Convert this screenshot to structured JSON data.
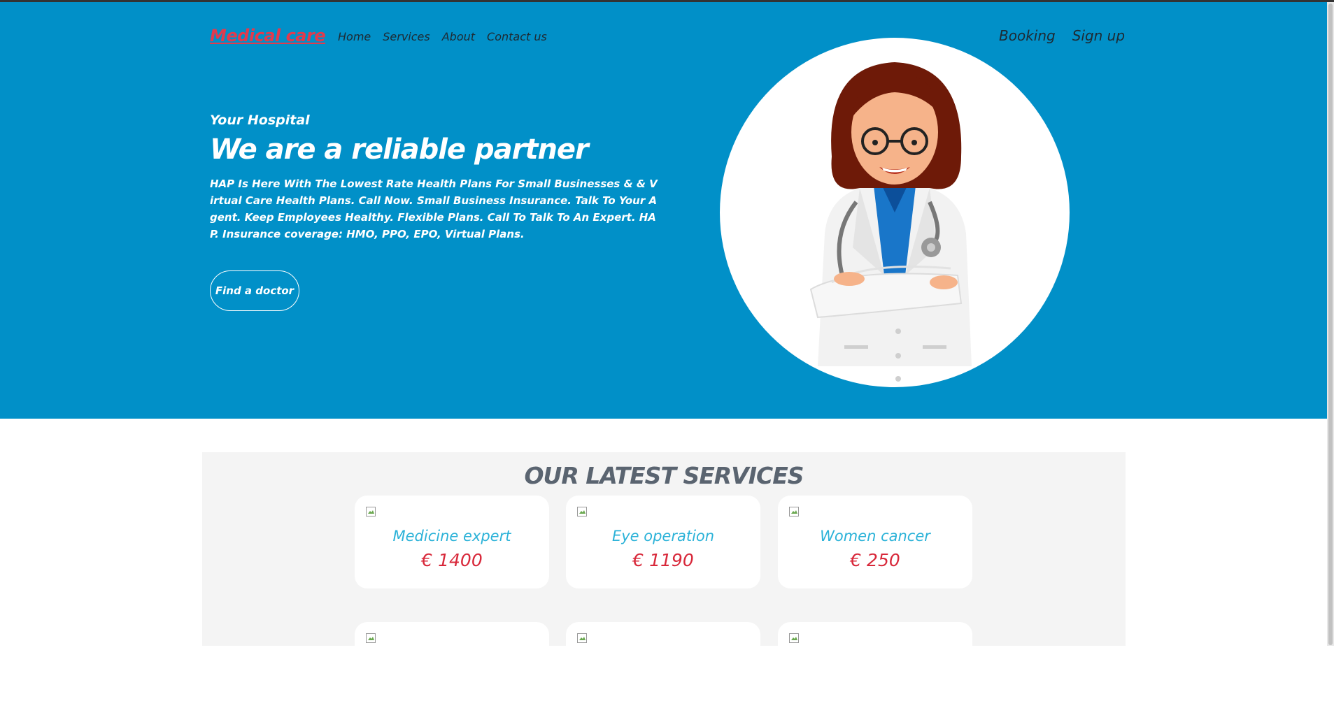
{
  "header": {
    "logo": "Medical care",
    "nav": [
      "Home",
      "Services",
      "About",
      "Contact us"
    ],
    "actions": [
      "Booking",
      "Sign up"
    ]
  },
  "hero": {
    "eyebrow": "Your Hospital",
    "headline": "We are a reliable partner",
    "description": "HAP Is Here With The Lowest Rate Health Plans For Small Businesses & & Virtual Care Health Plans. Call Now. Small Business Insurance. Talk To Your Agent. Keep Employees Healthy. Flexible Plans. Call To Talk To An Expert. HAP. Insurance coverage: HMO, PPO, EPO, Virtual Plans.",
    "cta": "Find a doctor"
  },
  "services": {
    "title": "OUR LATEST SERVICES",
    "items": [
      {
        "name": "Medicine expert",
        "price": "€ 1400"
      },
      {
        "name": "Eye operation",
        "price": "€ 1190"
      },
      {
        "name": "Women cancer",
        "price": "€ 250"
      }
    ]
  },
  "colors": {
    "hero_bg": "#0190c8",
    "logo": "#e23a4d",
    "service_name": "#2bb2d8",
    "price": "#d8283a"
  }
}
